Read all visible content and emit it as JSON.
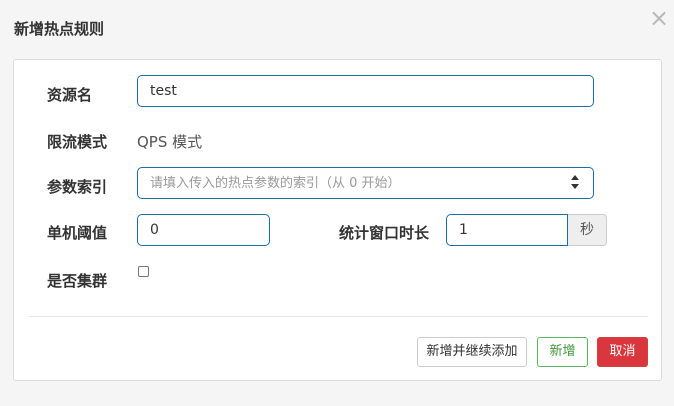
{
  "dialog": {
    "title": "新增热点规则",
    "close_glyph": "×"
  },
  "form": {
    "resource_name": {
      "label": "资源名",
      "value": "test"
    },
    "limit_mode": {
      "label": "限流模式",
      "value": "QPS 模式"
    },
    "param_index": {
      "label": "参数索引",
      "placeholder": "请填入传入的热点参数的索引（从 0 开始）"
    },
    "threshold": {
      "label": "单机阈值",
      "value": "0"
    },
    "stat_window": {
      "label": "统计窗口时长",
      "value": "1",
      "unit": "秒"
    },
    "cluster_mode": {
      "label": "是否集群",
      "checked": false
    }
  },
  "footer": {
    "add_continue_label": "新增并继续添加",
    "add_label": "新增",
    "cancel_label": "取消"
  },
  "colors": {
    "input_border": "#1a6fa3",
    "success": "#5cb85c",
    "danger": "#d9363e"
  }
}
